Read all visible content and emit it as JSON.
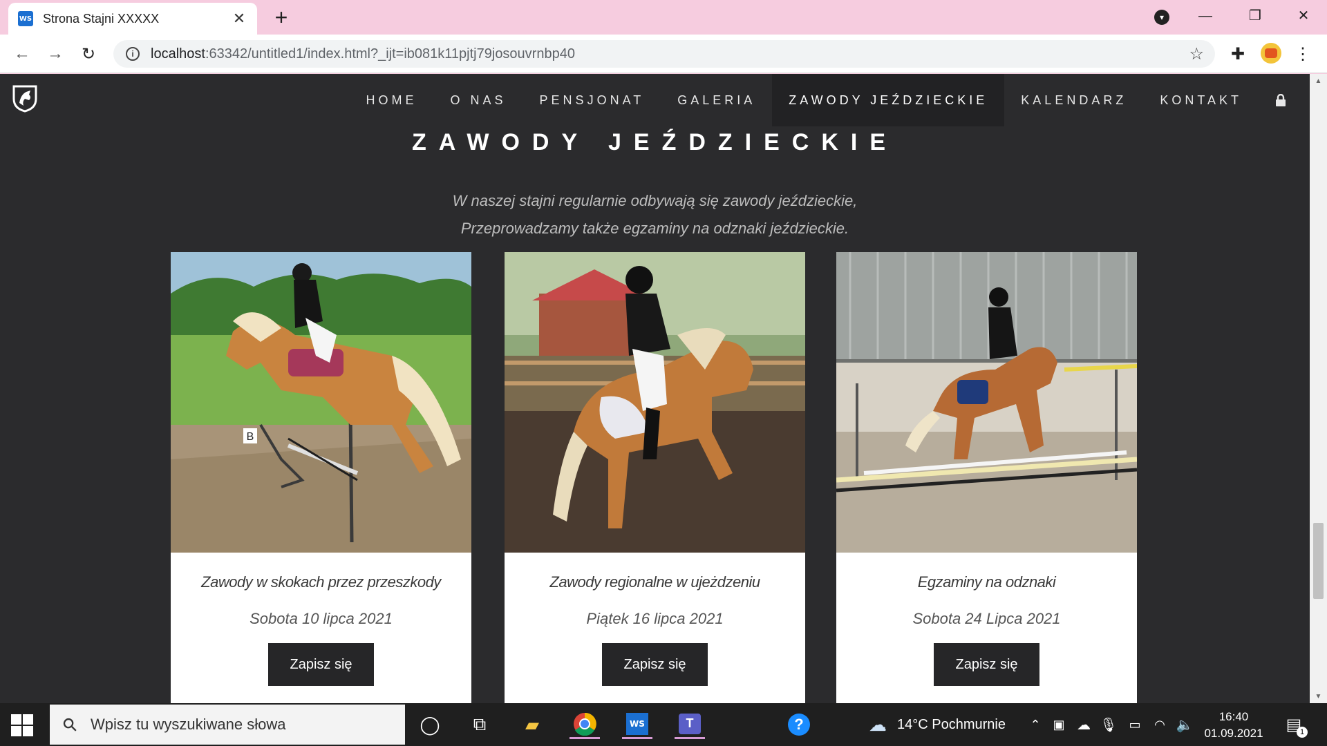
{
  "browser": {
    "tab_title": "Strona Stajni XXXXX",
    "tab_favicon_text": "WS",
    "url_host": "localhost",
    "url_rest": ":63342/untitled1/index.html?_ijt=ib081k11pjtj79josouvrnbp40"
  },
  "site": {
    "nav": [
      "HOME",
      "O NAS",
      "PENSJONAT",
      "GALERIA",
      "ZAWODY JEŹDZIECKIE",
      "KALENDARZ",
      "KONTAKT"
    ],
    "active_nav": "ZAWODY JEŹDZIECKIE",
    "title": "ZAWODY JEŹDZIECKIE",
    "intro_line1": "W naszej stajni regularnie odbywają się zawody jeździeckie,",
    "intro_line2": "Przeprowadzamy także egzaminy na odznaki jeździeckie.",
    "cards": [
      {
        "title": "Zawody w skokach przez przeszkody",
        "date": "Sobota 10 lipca 2021",
        "button": "Zapisz się",
        "photo_sign": "B"
      },
      {
        "title": "Zawody regionalne w ujeżdzeniu",
        "date": "Piątek 16 lipca 2021",
        "button": "Zapisz się"
      },
      {
        "title": "Egzaminy na odznaki",
        "date": "Sobota 24 Lipca 2021",
        "button": "Zapisz się"
      }
    ]
  },
  "taskbar": {
    "search_placeholder": "Wpisz tu wyszukiwane słowa",
    "weather": "14°C  Pochmurnie",
    "time": "16:40",
    "date": "01.09.2021",
    "notification_count": "1"
  },
  "colors": {
    "page_bg": "#2b2b2d",
    "nav_active_bg": "#222224",
    "button_bg": "#262628",
    "tab_strip": "#f6ccdf"
  }
}
